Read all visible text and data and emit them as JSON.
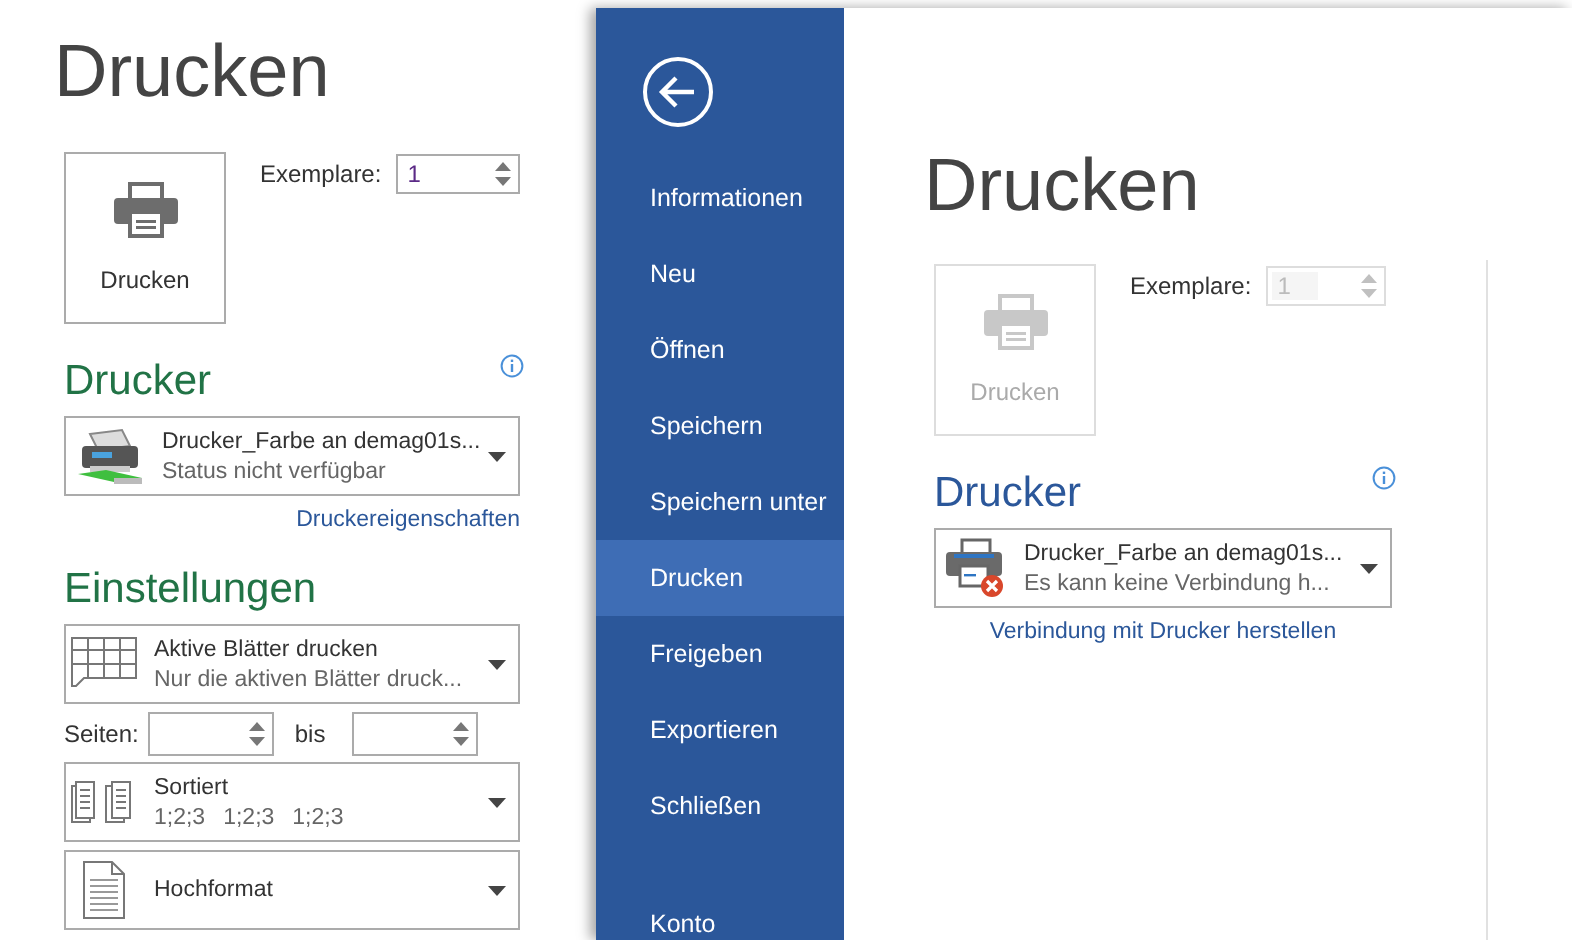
{
  "back_window": {
    "title": "Drucken",
    "print_button": {
      "label": "Drucken",
      "disabled": false
    },
    "copies": {
      "label": "Exemplare:",
      "value": "1",
      "disabled": false
    },
    "printer": {
      "heading": "Drucker",
      "name": "Drucker_Farbe an demag01s...",
      "status": "Status nicht verfügbar",
      "kind": "network",
      "link": "Druckereigenschaften"
    },
    "settings": {
      "heading": "Einstellungen",
      "items": [
        {
          "kind": "sheets",
          "title": "Aktive Blätter drucken",
          "subtitle": "Nur die aktiven Blätter druck..."
        },
        {
          "kind": "pages",
          "label": "Seiten:",
          "between": "bis"
        },
        {
          "kind": "collation",
          "title": "Sortiert",
          "parts": [
            "1;2;3",
            "1;2;3",
            "1;2;3"
          ]
        },
        {
          "kind": "orientation",
          "title": "Hochformat"
        }
      ]
    }
  },
  "front_window": {
    "nav": [
      {
        "label": "Informationen",
        "selected": false
      },
      {
        "label": "Neu",
        "selected": false
      },
      {
        "label": "Öffnen",
        "selected": false
      },
      {
        "label": "Speichern",
        "selected": false
      },
      {
        "label": "Speichern unter",
        "selected": false
      },
      {
        "label": "Drucken",
        "selected": true
      },
      {
        "label": "Freigeben",
        "selected": false
      },
      {
        "label": "Exportieren",
        "selected": false
      },
      {
        "label": "Schließen",
        "selected": false
      }
    ],
    "account": "Konto",
    "title": "Drucken",
    "print_button": {
      "label": "Drucken",
      "disabled": true
    },
    "copies": {
      "label": "Exemplare:",
      "value": "1",
      "disabled": true
    },
    "printer": {
      "heading": "Drucker",
      "name": "Drucker_Farbe an demag01s...",
      "status": "Es kann keine Verbindung h...",
      "kind": "offline",
      "link": "Verbindung mit Drucker herstellen"
    }
  }
}
